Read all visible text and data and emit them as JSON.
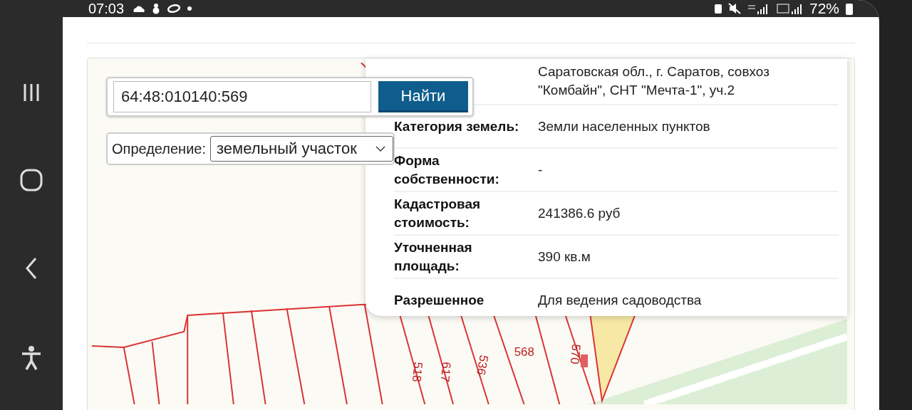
{
  "status_bar": {
    "time": "07:03",
    "battery": "72%"
  },
  "search": {
    "value": "64:48:010140:569",
    "button": "Найти"
  },
  "definition": {
    "label": "Определение:",
    "value": "земельный участок"
  },
  "info_rows": [
    {
      "value": "Саратовская обл., г. Саратов, совхоз \"Комбайн\", СНТ \"Мечта-1\", уч.2"
    },
    {
      "label": "Категория земель:",
      "value": "Земли населенных пунктов"
    },
    {
      "label": "Форма собственности:",
      "value": "-"
    },
    {
      "label": "Кадастровая стоимость:",
      "value": "241386.6 руб"
    },
    {
      "label": "Уточненная площадь:",
      "value": "390 кв.м"
    },
    {
      "label": "Разрешенное",
      "value": "Для ведения садоводства"
    }
  ],
  "map": {
    "parcel_numbers": [
      "518",
      "617",
      "536",
      "568",
      "570"
    ]
  }
}
